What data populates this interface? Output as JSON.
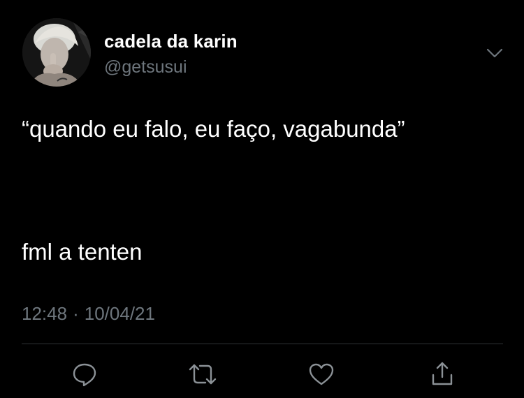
{
  "user": {
    "display_name": "cadela da karin",
    "handle": "@getsusui"
  },
  "tweet": {
    "lines": [
      "“quando eu falo, eu faço, vagabunda”",
      "fml a tenten"
    ],
    "time": "12:48",
    "separator": "·",
    "date": "10/04/21"
  },
  "actions": {
    "icons": [
      "reply-icon",
      "retweet-icon",
      "like-icon",
      "share-icon"
    ]
  },
  "colors": {
    "background": "#000000",
    "text": "#ffffff",
    "muted": "#6e767d",
    "divider": "#2f3336"
  }
}
